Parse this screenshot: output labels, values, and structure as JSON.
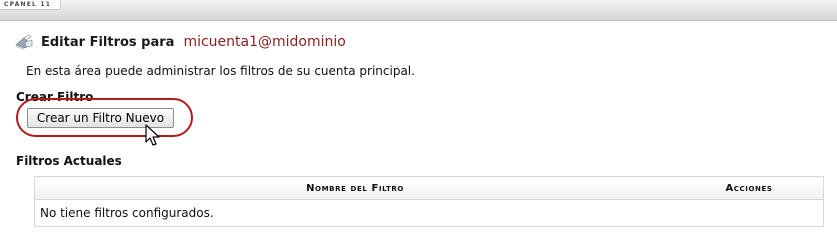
{
  "header": {
    "brand": "CPANEL 11"
  },
  "page": {
    "title_label": "Editar Filtros para",
    "account": "micuenta1@midominio",
    "icon": "mail-filter-icon",
    "intro": "En esta área puede administrar los filtros de su cuenta principal."
  },
  "create_section": {
    "heading": "Crear Filtro",
    "button_label": "Crear un Filtro Nuevo"
  },
  "current_section": {
    "heading": "Filtros Actuales",
    "table": {
      "columns": [
        "Nombre del Filtro",
        "Acciones"
      ],
      "empty_message": "No tiene filtros configurados."
    }
  },
  "colors": {
    "account_text": "#8a1f1f",
    "highlight": "#b31b1b"
  }
}
